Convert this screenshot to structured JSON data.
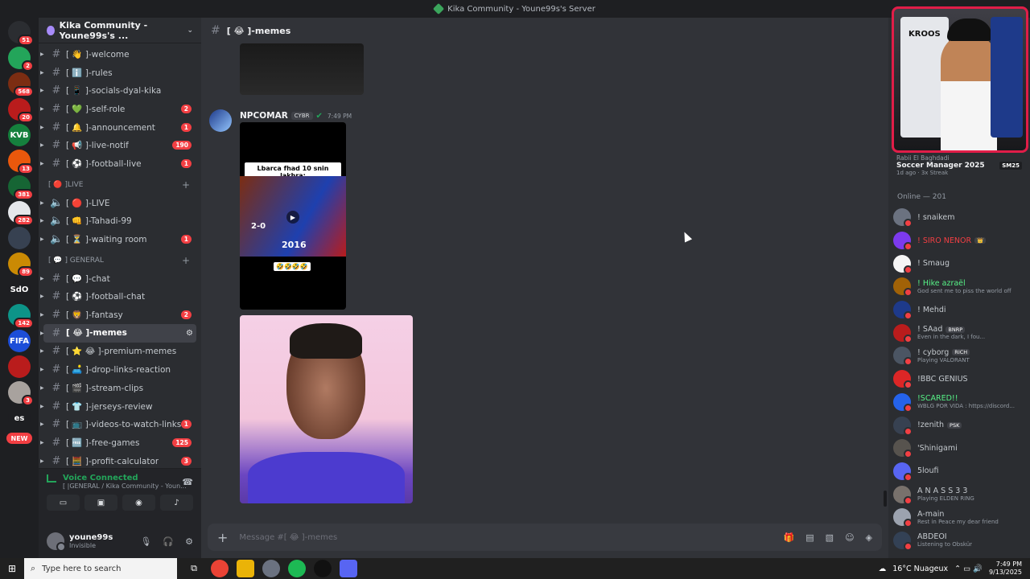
{
  "window": {
    "title": "Kika Community - Youne99s's Server"
  },
  "rail": {
    "servers": [
      {
        "icon": "discord-logo-icon",
        "badge": "51",
        "color": "#2b2d31"
      },
      {
        "icon": "discord-home-icon",
        "badge": "2",
        "color": "#23a55a"
      },
      {
        "icon": "server-icon",
        "badge": "568",
        "color": "#7c2d12"
      },
      {
        "icon": "server-icon",
        "badge": "20",
        "color": "#b91c1c"
      },
      {
        "icon": "server-icon",
        "label": "KVB",
        "color": "#15803d"
      },
      {
        "icon": "server-icon",
        "badge": "13",
        "color": "#ea580c"
      },
      {
        "icon": "server-icon",
        "badge": "381",
        "color": "#166534"
      },
      {
        "icon": "server-icon",
        "badge": "282",
        "color": "#e5e7eb"
      },
      {
        "icon": "server-icon",
        "color": "#374151"
      },
      {
        "icon": "server-icon",
        "badge": "89",
        "color": "#ca8a04"
      },
      {
        "icon": "server-icon",
        "label": "SdO",
        "color": "#1e1f22"
      },
      {
        "icon": "server-icon",
        "badge": "142",
        "color": "#0d9488"
      },
      {
        "icon": "server-icon",
        "label": "FIFA",
        "color": "#1d4ed8"
      },
      {
        "icon": "server-icon",
        "color": "#b91c1c"
      },
      {
        "icon": "server-icon",
        "badge": "3",
        "color": "#a8a29e"
      },
      {
        "icon": "server-icon",
        "label": "es",
        "color": "#1e1f22"
      }
    ],
    "new_label": "NEW"
  },
  "sidebar": {
    "guild_name": "Kika Community - Youne99s's ...",
    "channels_top": [
      {
        "name": "[ 👋 ]-welcome"
      },
      {
        "name": "[ ℹ️ ]-rules"
      },
      {
        "name": "[ 📱 ]-socials-dyal-kika"
      },
      {
        "name": "[ 💚 ]-self-role",
        "count": "2"
      },
      {
        "name": "[ 🔔 ]-announcement",
        "count": "1"
      },
      {
        "name": "[ 📢 ]-live-notif",
        "count": "190"
      },
      {
        "name": "[ ⚽ ]-football-live",
        "count": "1"
      }
    ],
    "live_category": "[ 🔴 ]LIVE",
    "voice_channels": [
      {
        "name": "[ 🔴 ]-LIVE"
      },
      {
        "name": "[ 👊 ]-Tahadi-99"
      },
      {
        "name": "[ ⏳ ]-waiting room",
        "count": "1"
      }
    ],
    "general_category": "[ 💬 ] GENERAL",
    "channels_general": [
      {
        "name": "[ 💬 ]-chat"
      },
      {
        "name": "[ ⚽ ]-football-chat"
      },
      {
        "name": "[ 🦁 ]-fantasy",
        "count": "2"
      },
      {
        "name": "[ 😂 ]-memes",
        "active": true
      },
      {
        "name": "[ ⭐ 😂 ]-premium-memes"
      },
      {
        "name": "[ 🛋️ ]-drop-links-reaction"
      },
      {
        "name": "[ 🎬 ]-stream-clips"
      },
      {
        "name": "[ 👕 ]-jerseys-review"
      },
      {
        "name": "[ 📺 ]-videos-to-watch-links",
        "count": "1"
      },
      {
        "name": "[ 🆓 ]-free-games",
        "count": "125"
      },
      {
        "name": "[ 🧮 ]-profit-calculator",
        "count": "3"
      }
    ],
    "voice": {
      "status": "Voice Connected",
      "sub": "[ |GENERAL / Kika Community - Youn..."
    },
    "user": {
      "name": "youne99s",
      "status": "Invisible"
    }
  },
  "main": {
    "channel": "[ 😂 ]-memes",
    "message": {
      "author": "NPCOMAR",
      "tag": "CYBR",
      "time": "7:49 PM",
      "video_caption": "Lbarca fhad 10 snin lakhra:",
      "video_score": "2-0",
      "video_year": "2016",
      "video_emojis": "🤣🤣🤣🤣"
    },
    "composer_placeholder": "Message #[ 😂 ]-memes"
  },
  "members": {
    "webcam_text": "KROOS",
    "activity": {
      "header": "Rabii El Baghdadi",
      "title": "Soccer Manager 2025",
      "badge": "SM25",
      "sub": "1d ago · 3x Streak"
    },
    "online_header": "Online — 201",
    "list": [
      {
        "name": "! snaikem",
        "color": "#c4c9ce"
      },
      {
        "name": "! SIRO NENOR",
        "color": "#f23f43",
        "tag": "👑"
      },
      {
        "name": "! Smaug",
        "color": "#c4c9ce"
      },
      {
        "name": "! Hike azraël",
        "color": "#57f287",
        "sub": "God sent me to piss the world off"
      },
      {
        "name": "! Mehdi",
        "color": "#c4c9ce"
      },
      {
        "name": "! SAad",
        "color": "#c4c9ce",
        "tag": "BNRP",
        "sub": "Even in the dark, I fou..."
      },
      {
        "name": "! cyborg",
        "color": "#c4c9ce",
        "tag": "RICH",
        "sub": "Playing VALORANT"
      },
      {
        "name": "!BBC GENIUS",
        "color": "#c4c9ce"
      },
      {
        "name": "!SCARED!!",
        "color": "#57f287",
        "sub": "WBLG POR VIDA : https://discord..."
      },
      {
        "name": "!zenith",
        "color": "#c4c9ce",
        "tag": "PSK"
      },
      {
        "name": "'Shinigami",
        "color": "#c4c9ce"
      },
      {
        "name": "5loufi",
        "color": "#c4c9ce"
      },
      {
        "name": "A N A S S 3 3",
        "color": "#c4c9ce",
        "sub": "Playing ELDEN RING"
      },
      {
        "name": "A-main",
        "color": "#c4c9ce",
        "sub": "Rest in Peace my dear friend"
      },
      {
        "name": "ABDEOI",
        "color": "#c4c9ce",
        "sub": "Listening to Obskür"
      }
    ]
  },
  "taskbar": {
    "search_placeholder": "Type here to search",
    "weather": "16°C  Nuageux",
    "time": "7:49 PM",
    "date": "9/13/2025"
  }
}
